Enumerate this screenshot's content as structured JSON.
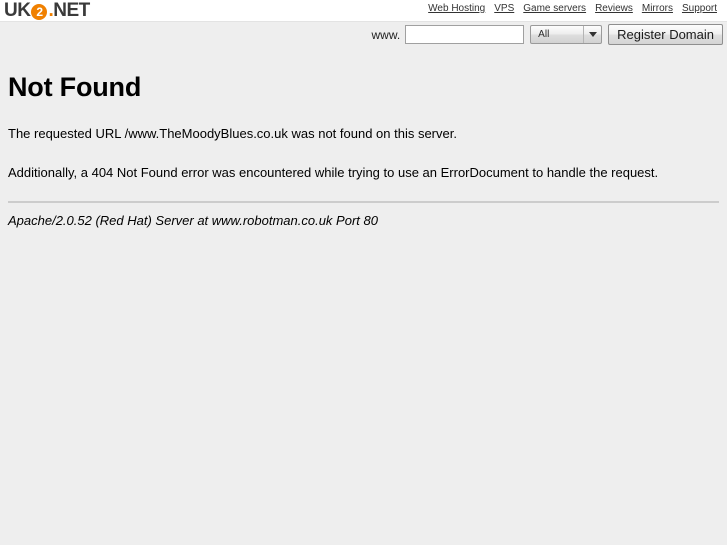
{
  "header": {
    "logo": {
      "prefix": "UK",
      "circle": "2",
      "dot": ".",
      "suffix": "NET"
    },
    "nav": [
      {
        "label": "Web Hosting"
      },
      {
        "label": "VPS"
      },
      {
        "label": "Game servers"
      },
      {
        "label": "Reviews"
      },
      {
        "label": "Mirrors"
      },
      {
        "label": "Support"
      }
    ]
  },
  "domain_search": {
    "www_label": "www.",
    "input_value": "",
    "input_placeholder": "",
    "tld_selected": "All",
    "tld_options": [
      "All"
    ],
    "register_label": "Register Domain"
  },
  "main": {
    "title": "Not Found",
    "paragraph_1": "The requested URL /www.TheMoodyBlues.co.uk was not found on this server.",
    "paragraph_2": "Additionally, a 404 Not Found error was encountered while trying to use an ErrorDocument to handle the request.",
    "signature": "Apache/2.0.52 (Red Hat) Server at www.robotman.co.uk Port 80"
  },
  "colors": {
    "page_background": "#eeeeee",
    "header_background": "#ffffff",
    "brand_orange": "#f08000",
    "text": "#000000",
    "divider": "#cccccc"
  }
}
